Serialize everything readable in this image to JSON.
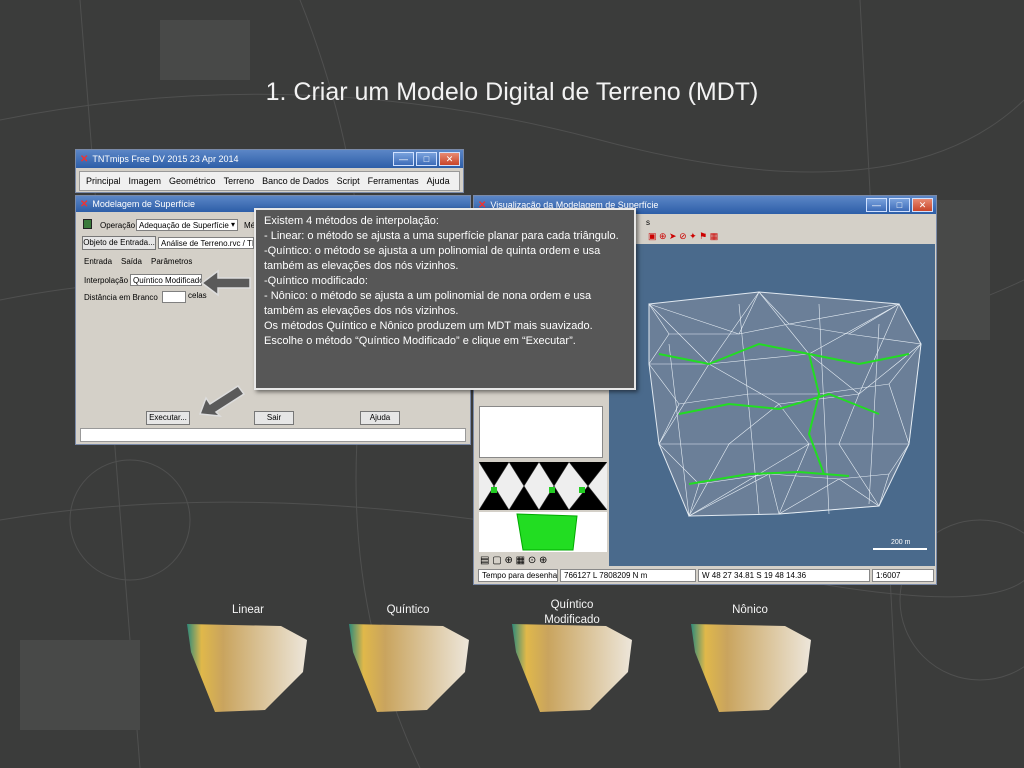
{
  "slide": {
    "title": "1. Criar um Modelo Digital de Terreno (MDT)"
  },
  "main_window": {
    "title": "TNTmips Free DV 2015   23 Apr 2014",
    "menu": [
      "Principal",
      "Imagem",
      "Geométrico",
      "Terreno",
      "Banco de Dados",
      "Script",
      "Ferramentas",
      "Ajuda"
    ]
  },
  "surface_dialog": {
    "title": "Modelagem de Superfície",
    "operation_label": "Operação",
    "operation_value": "Adequação de Superfície",
    "method_label_partial": "Mé",
    "input_button": "Objeto de Entrada...",
    "input_value": "Análise de Terreno.rvc / TIN",
    "tabs": [
      "Entrada",
      "Saída",
      "Parâmetros"
    ],
    "interp_label": "Interpolação",
    "interp_value": "Quíntico Modificado",
    "blank_label": "Distância em Branco",
    "blank_unit": "celas",
    "buttons": {
      "execute": "Executar...",
      "exit": "Sair",
      "help": "Ajuda"
    }
  },
  "viz_window": {
    "title": "Visualização da Modelagem de Superfície",
    "menu_partial": "s",
    "scale_label": "200 m",
    "status": {
      "time_label": "Tempo para desenhar",
      "coords": "766127 L  7808209 N m",
      "geo": "W 48 27 34.81  S 19 48 14.36",
      "scale": "1:6007"
    }
  },
  "callout": {
    "lines": [
      "Existem 4 métodos de interpolação:",
      "- Linear: o método se ajusta a uma superfície planar para cada triângulo.",
      "-Quíntico: o método se ajusta a um polinomial de quinta ordem e usa também as elevações dos nós vizinhos.",
      "-Quíntico modificado:",
      "- Nônico: o método se ajusta a um polinomial de nona ordem e usa também as elevações dos nós vizinhos.",
      "Os métodos Quíntico e Nônico produzem um MDT mais suavizado.",
      "Escolhe o método “Quíntico Modificado” e clique em “Executar”."
    ]
  },
  "results": {
    "linear": "Linear",
    "quintic": "Quíntico",
    "mod_quintic_1": "Quíntico",
    "mod_quintic_2": "Modificado",
    "nonic": "Nônico"
  },
  "colors": {
    "titlebar": "#2d5ea8",
    "map_bg": "#4a6a8c",
    "tin_green": "#22dd22",
    "callout_bg": "#575757"
  }
}
